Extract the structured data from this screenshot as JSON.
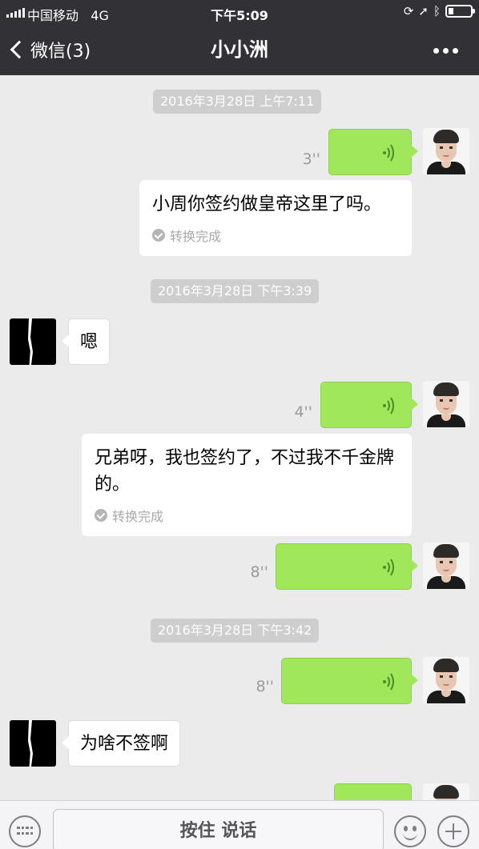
{
  "status_bar": {
    "carrier": "中国移动",
    "network": "4G",
    "time": "下午5:09",
    "icons": [
      "signal-icon",
      "orientation-lock-icon",
      "location-icon",
      "bluetooth-icon",
      "battery-icon"
    ]
  },
  "nav": {
    "back_label": "微信(3)",
    "title": "小小洲",
    "more_icon": "more-icon"
  },
  "chat": {
    "timestamps": [
      "2016年3月28日 上午7:11",
      "2016年3月28日 下午3:39",
      "2016年3月28日 下午3:42"
    ],
    "voice_messages": [
      {
        "sender": "me",
        "duration": "3''"
      },
      {
        "sender": "me",
        "duration": "4''"
      },
      {
        "sender": "me",
        "duration": "8''"
      },
      {
        "sender": "me",
        "duration": "8''"
      }
    ],
    "voice_to_text": [
      {
        "text": "小周你签约做皇帝这里了吗。",
        "status": "转换完成"
      },
      {
        "text": "兄弟呀，我也签约了，不过我不千金牌的。",
        "status": "转换完成"
      }
    ],
    "incoming_texts": [
      "嗯",
      "为啥不签啊"
    ]
  },
  "input_bar": {
    "hold_to_talk": "按住 说话",
    "icons": [
      "keyboard-icon",
      "emoji-icon",
      "plus-icon"
    ]
  },
  "colors": {
    "nav_bg": "#323236",
    "chat_bg": "#ebebeb",
    "outgoing_bubble": "#a0e75a",
    "incoming_bubble": "#ffffff"
  }
}
